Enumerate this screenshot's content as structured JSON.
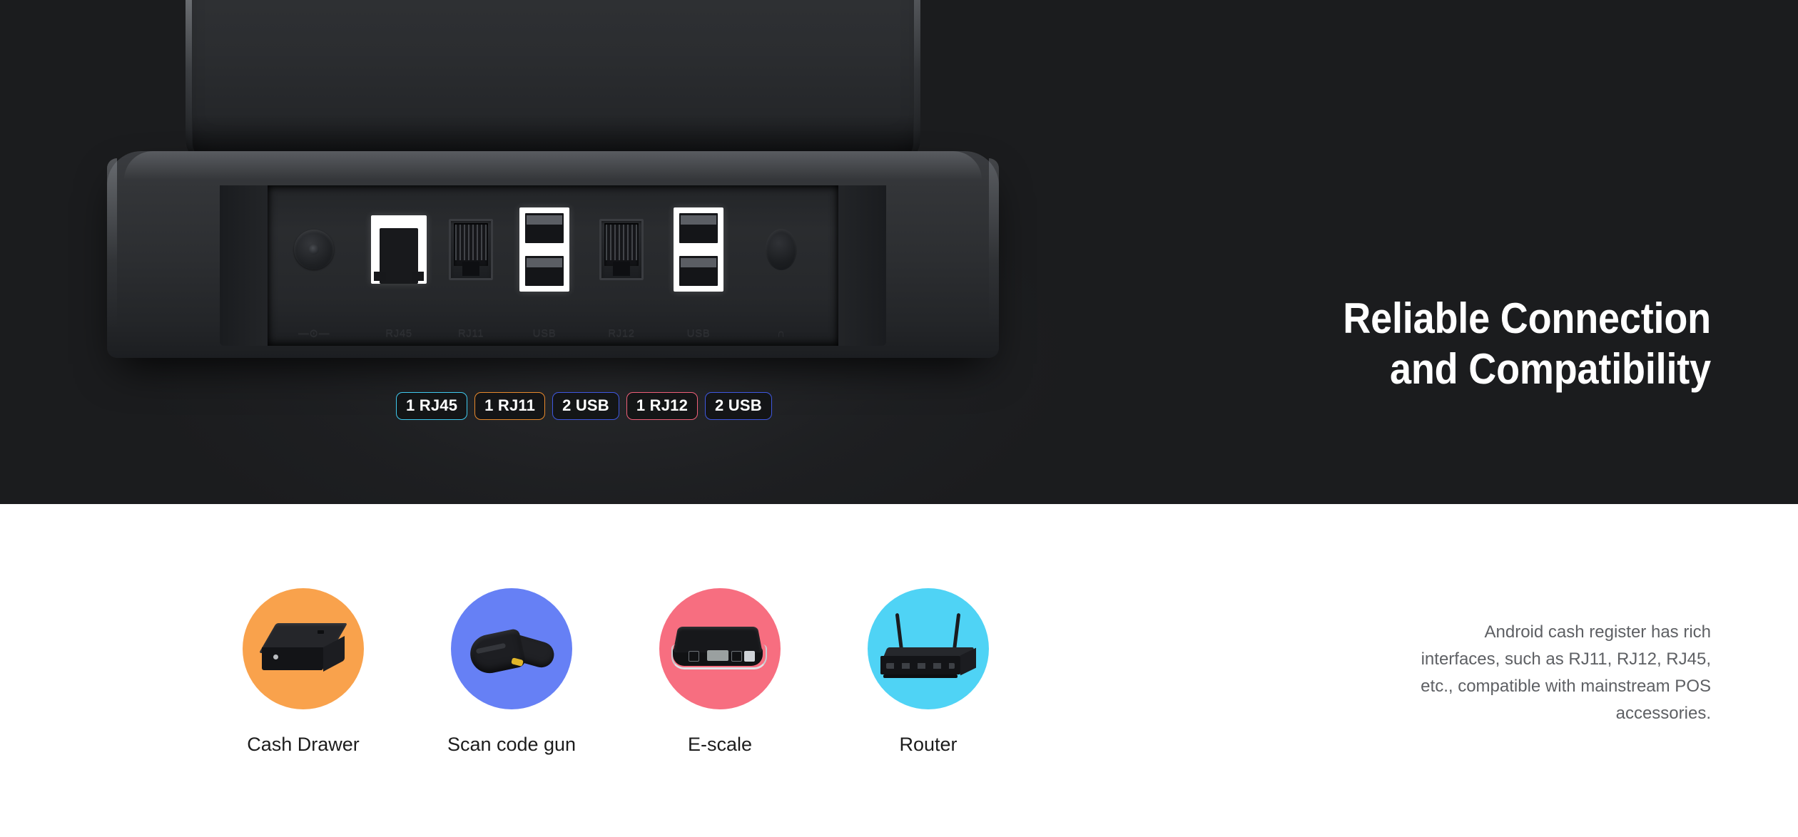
{
  "hero": {
    "headline_line1": "Reliable Connection",
    "headline_line2": "and Compatibility",
    "background_color": "#1b1c1e",
    "device": {
      "name": "android-pos-terminal",
      "port_panel": {
        "engraved_labels": [
          "—⊙—",
          "RJ45",
          "RJ11",
          "USB",
          "RJ12",
          "USB",
          "∩"
        ],
        "ports": [
          {
            "name": "power-jack",
            "type": "power"
          },
          {
            "name": "rj45-port",
            "type": "rj45"
          },
          {
            "name": "rj11-port",
            "type": "rj11"
          },
          {
            "name": "usb-port-pair-1",
            "type": "usb-dual"
          },
          {
            "name": "rj12-port",
            "type": "rj12"
          },
          {
            "name": "usb-port-pair-2",
            "type": "usb-dual"
          },
          {
            "name": "audio-jack",
            "type": "audio"
          }
        ]
      }
    },
    "badges": [
      {
        "label": "1 RJ45",
        "color": "#3fc9ee"
      },
      {
        "label": "1 RJ11",
        "color": "#e8892c"
      },
      {
        "label": "2 USB",
        "color": "#3f58e0"
      },
      {
        "label": "1 RJ12",
        "color": "#ef5f78"
      },
      {
        "label": "2 USB",
        "color": "#3f58e0"
      }
    ]
  },
  "accessories": {
    "items": [
      {
        "label": "Cash Drawer",
        "icon": "cash-drawer-icon",
        "circle_color": "#f9a24c"
      },
      {
        "label": "Scan code gun",
        "icon": "barcode-scanner-icon",
        "circle_color": "#6680f5"
      },
      {
        "label": "E-scale",
        "icon": "digital-scale-icon",
        "circle_color": "#f76e80"
      },
      {
        "label": "Router",
        "icon": "wifi-router-icon",
        "circle_color": "#4fd3f5"
      }
    ],
    "description": "Android cash register has rich interfaces, such as RJ11, RJ12, RJ45, etc., compatible with mainstream POS accessories."
  }
}
